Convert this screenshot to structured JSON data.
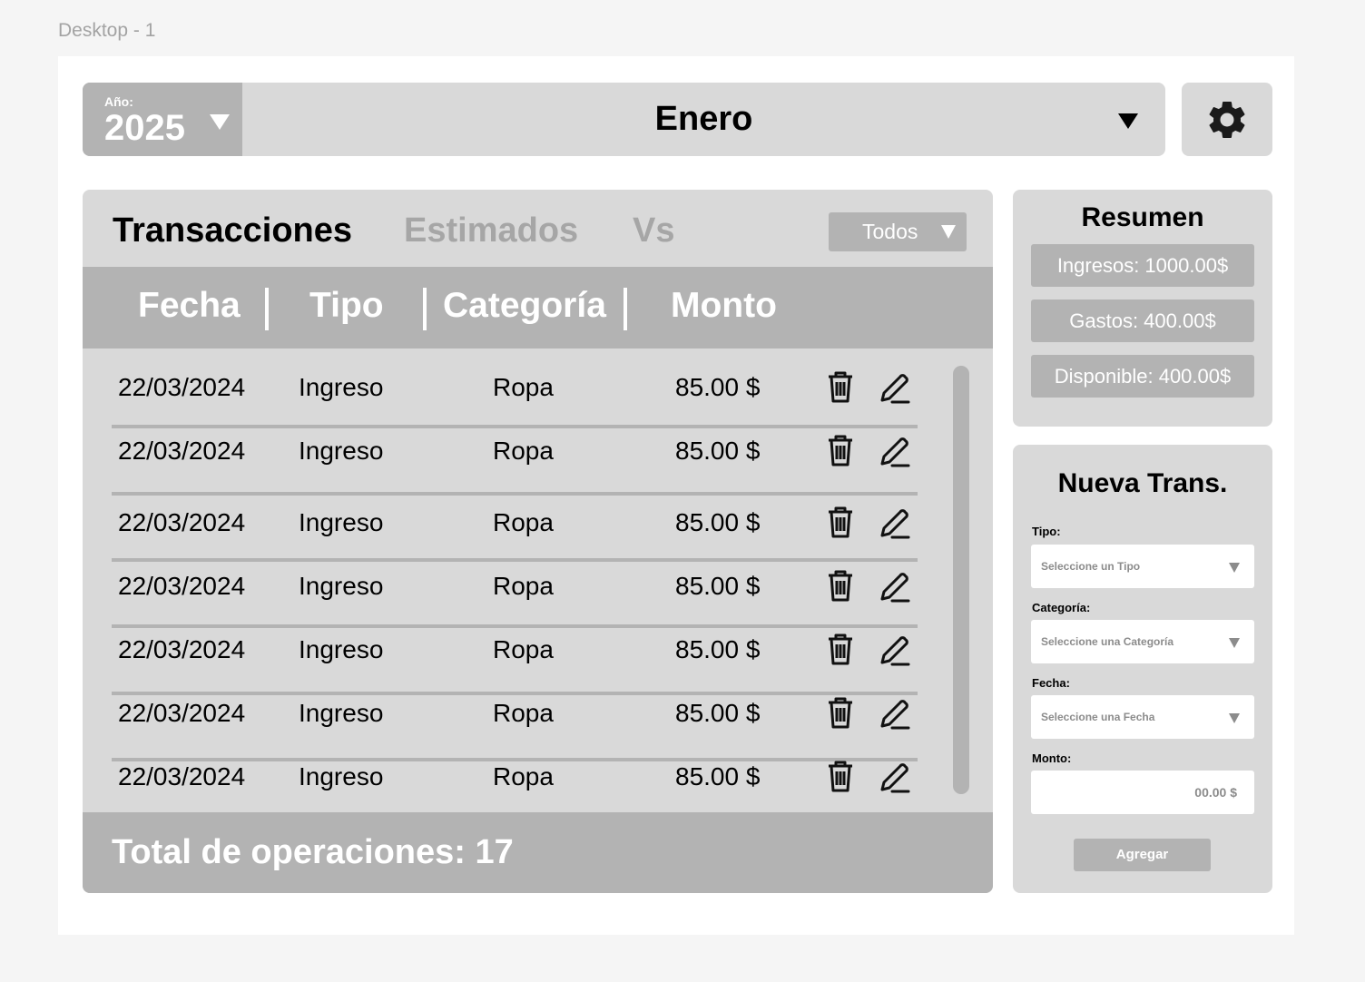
{
  "frame_label": "Desktop - 1",
  "header": {
    "year_label": "Año:",
    "year_value": "2025",
    "month": "Enero",
    "settings_icon": "gear-icon"
  },
  "tabs": [
    {
      "label": "Transacciones",
      "active": true
    },
    {
      "label": "Estimados",
      "active": false
    },
    {
      "label": "Vs",
      "active": false
    }
  ],
  "filter": {
    "selected": "Todos"
  },
  "table": {
    "columns": [
      "Fecha",
      "Tipo",
      "Categoría",
      "Monto"
    ],
    "rows": [
      {
        "fecha": "22/03/2024",
        "tipo": "Ingreso",
        "categoria": "Ropa",
        "monto": "85.00 $"
      },
      {
        "fecha": "22/03/2024",
        "tipo": "Ingreso",
        "categoria": "Ropa",
        "monto": "85.00 $"
      },
      {
        "fecha": "22/03/2024",
        "tipo": "Ingreso",
        "categoria": "Ropa",
        "monto": "85.00 $"
      },
      {
        "fecha": "22/03/2024",
        "tipo": "Ingreso",
        "categoria": "Ropa",
        "monto": "85.00 $"
      },
      {
        "fecha": "22/03/2024",
        "tipo": "Ingreso",
        "categoria": "Ropa",
        "monto": "85.00 $"
      },
      {
        "fecha": "22/03/2024",
        "tipo": "Ingreso",
        "categoria": "Ropa",
        "monto": "85.00 $"
      },
      {
        "fecha": "22/03/2024",
        "tipo": "Ingreso",
        "categoria": "Ropa",
        "monto": "85.00 $"
      }
    ],
    "row_icons": [
      "trash-icon",
      "pencil-icon"
    ],
    "total": "Total de operaciones: 17"
  },
  "summary": {
    "title": "Resumen",
    "ingresos": "Ingresos: 1000.00$",
    "gastos": "Gastos: 400.00$",
    "disponible": "Disponible: 400.00$"
  },
  "new_transaction": {
    "title": "Nueva Trans.",
    "tipo_label": "Tipo:",
    "tipo_placeholder": "Seleccione un Tipo",
    "categoria_label": "Categoría:",
    "categoria_placeholder": "Seleccione una Categoría",
    "fecha_label": "Fecha:",
    "fecha_placeholder": "Seleccione una Fecha",
    "monto_label": "Monto:",
    "monto_placeholder": "00.00 $",
    "add_label": "Agregar"
  },
  "colors": {
    "panel": "#d9d9d9",
    "accent_gray": "#b3b3b3",
    "text": "#000000",
    "inactive_tab": "#a6a6a6"
  }
}
